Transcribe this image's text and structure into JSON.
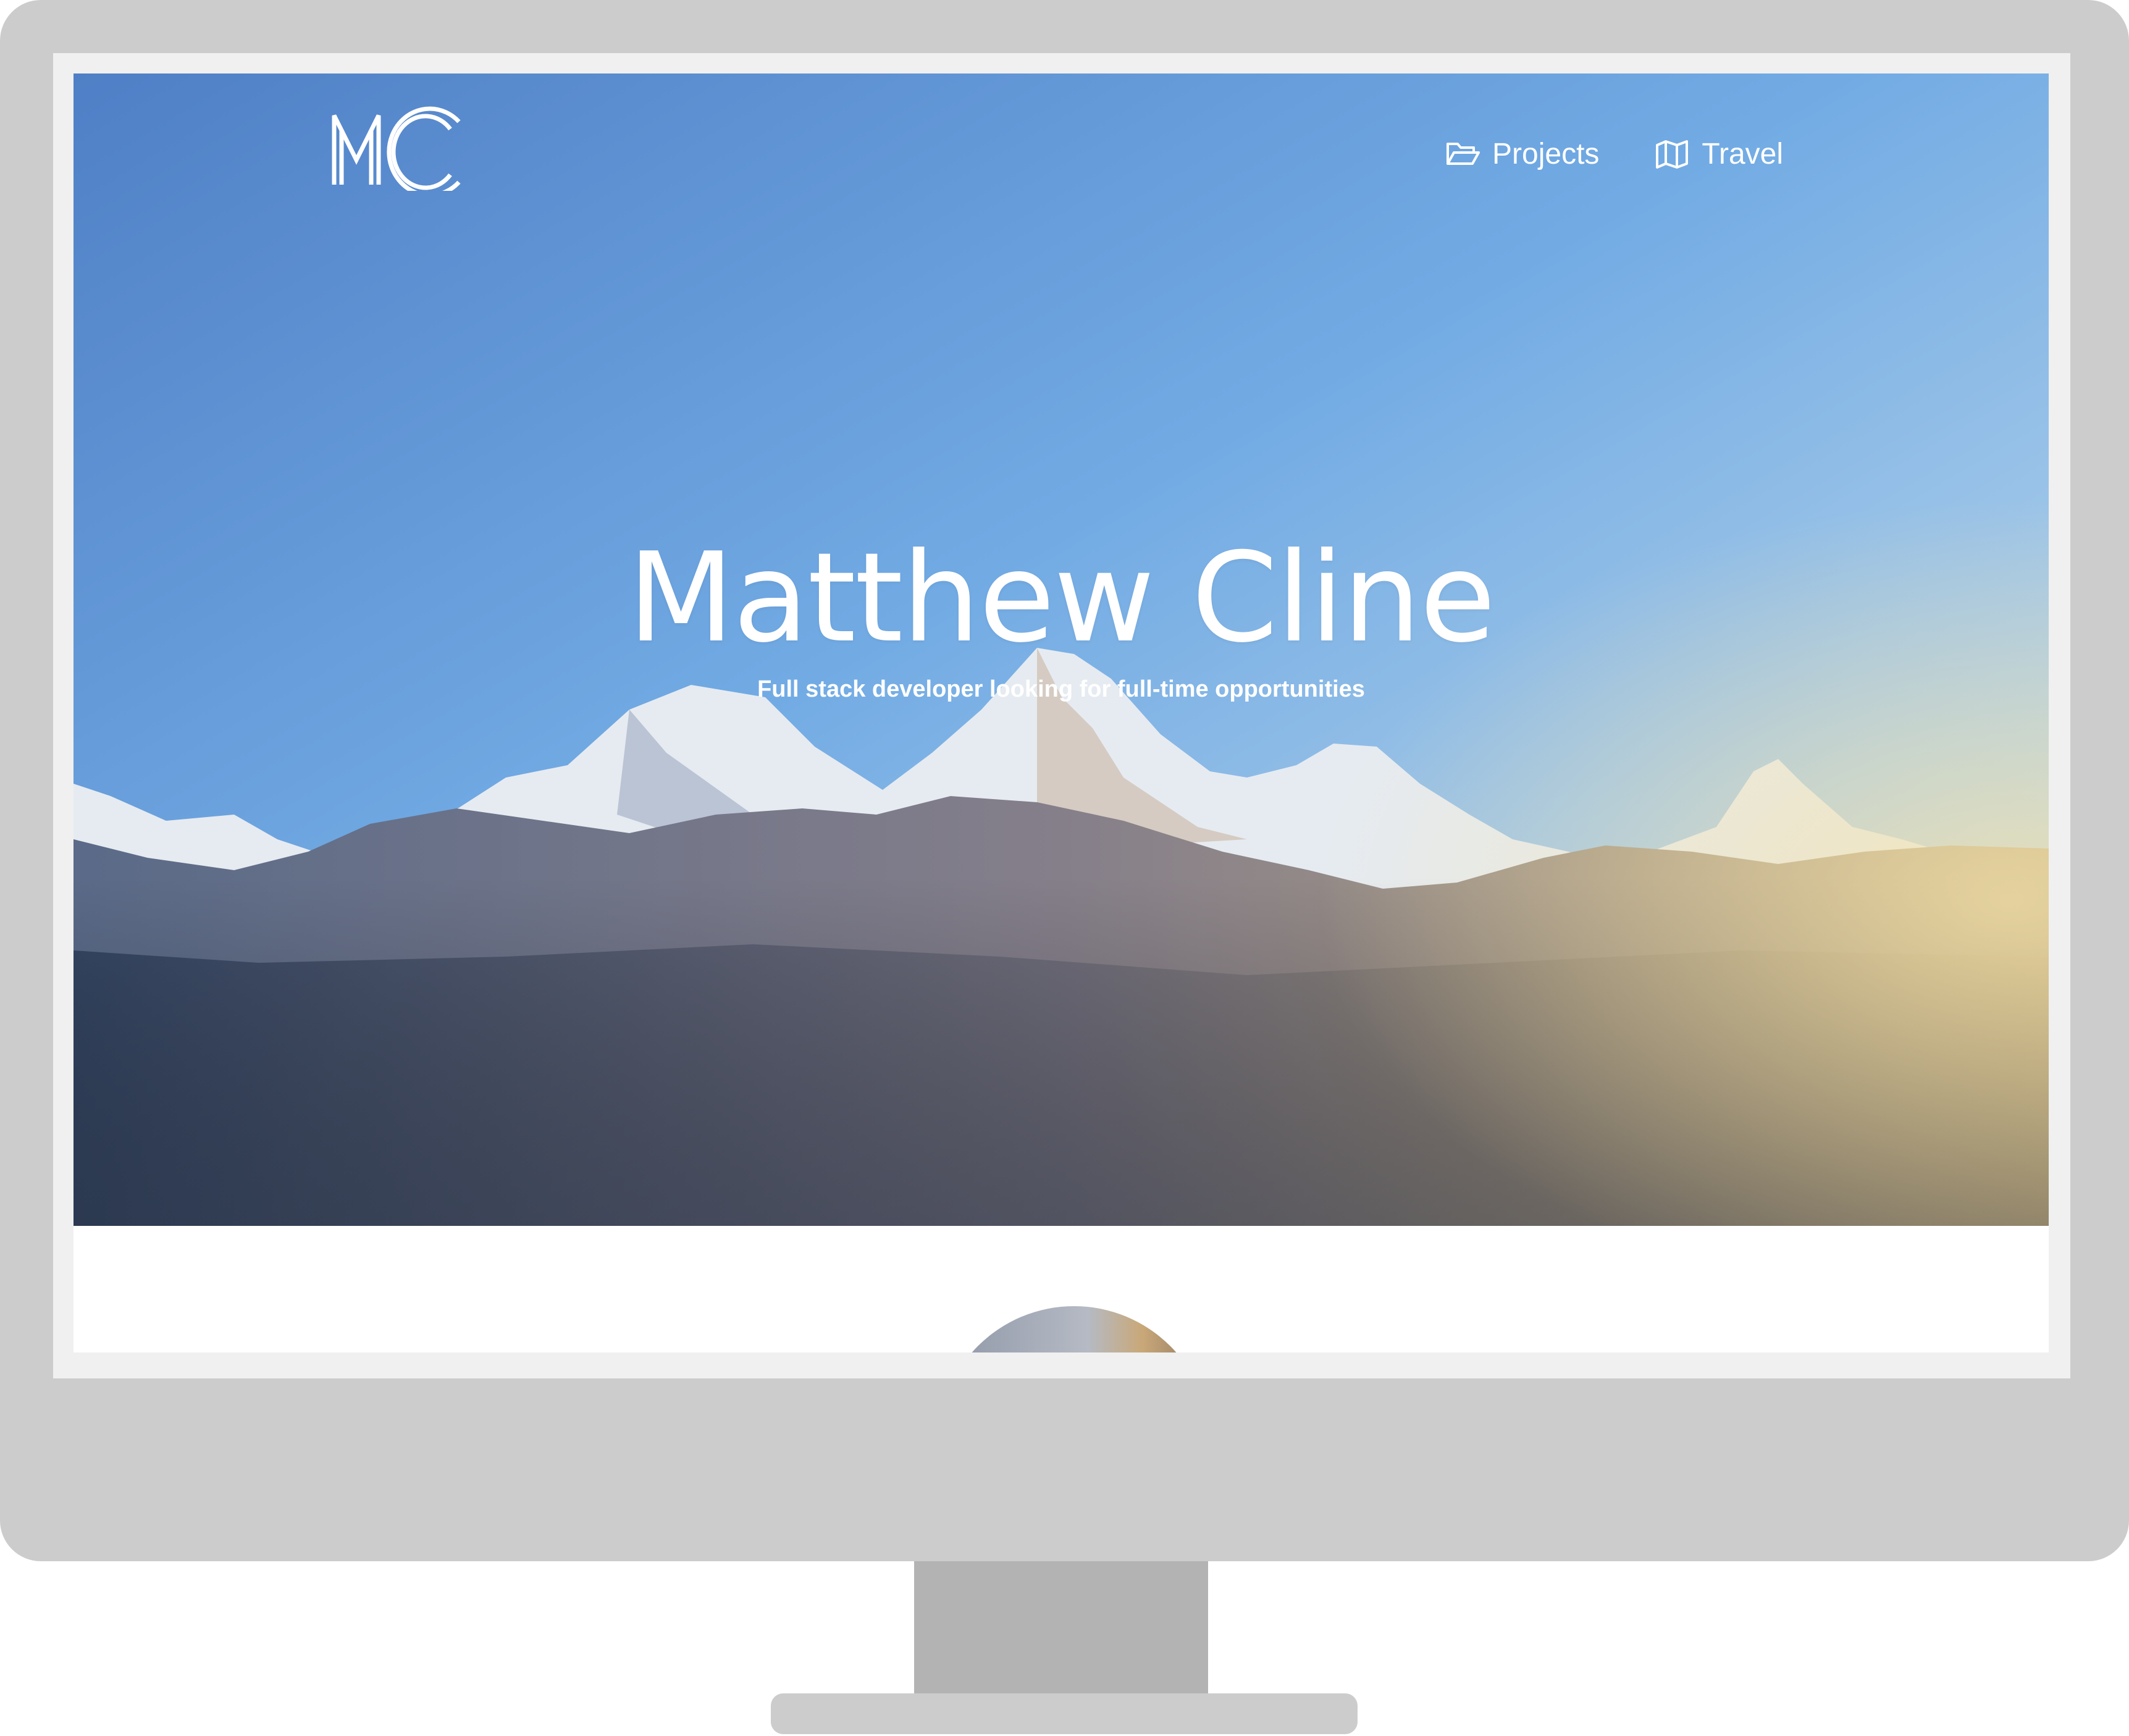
{
  "logo": {
    "text": "MC",
    "icon": "mc-monogram-logo"
  },
  "nav": {
    "items": [
      {
        "label": "Projects",
        "icon": "folder-open-icon"
      },
      {
        "label": "Travel",
        "icon": "map-icon"
      }
    ]
  },
  "hero": {
    "title": "Matthew Cline",
    "subtitle": "Full stack developer looking for full-time opportunities",
    "background": "mountain-sunrise-photo"
  },
  "colors": {
    "monitor_frame": "#cccccc",
    "monitor_stand": "#b3b3b3",
    "bezel": "#f0f0f0",
    "sky_top": "#5a8fd0",
    "sky_bottom": "#7ab4e8",
    "text": "#ffffff"
  }
}
